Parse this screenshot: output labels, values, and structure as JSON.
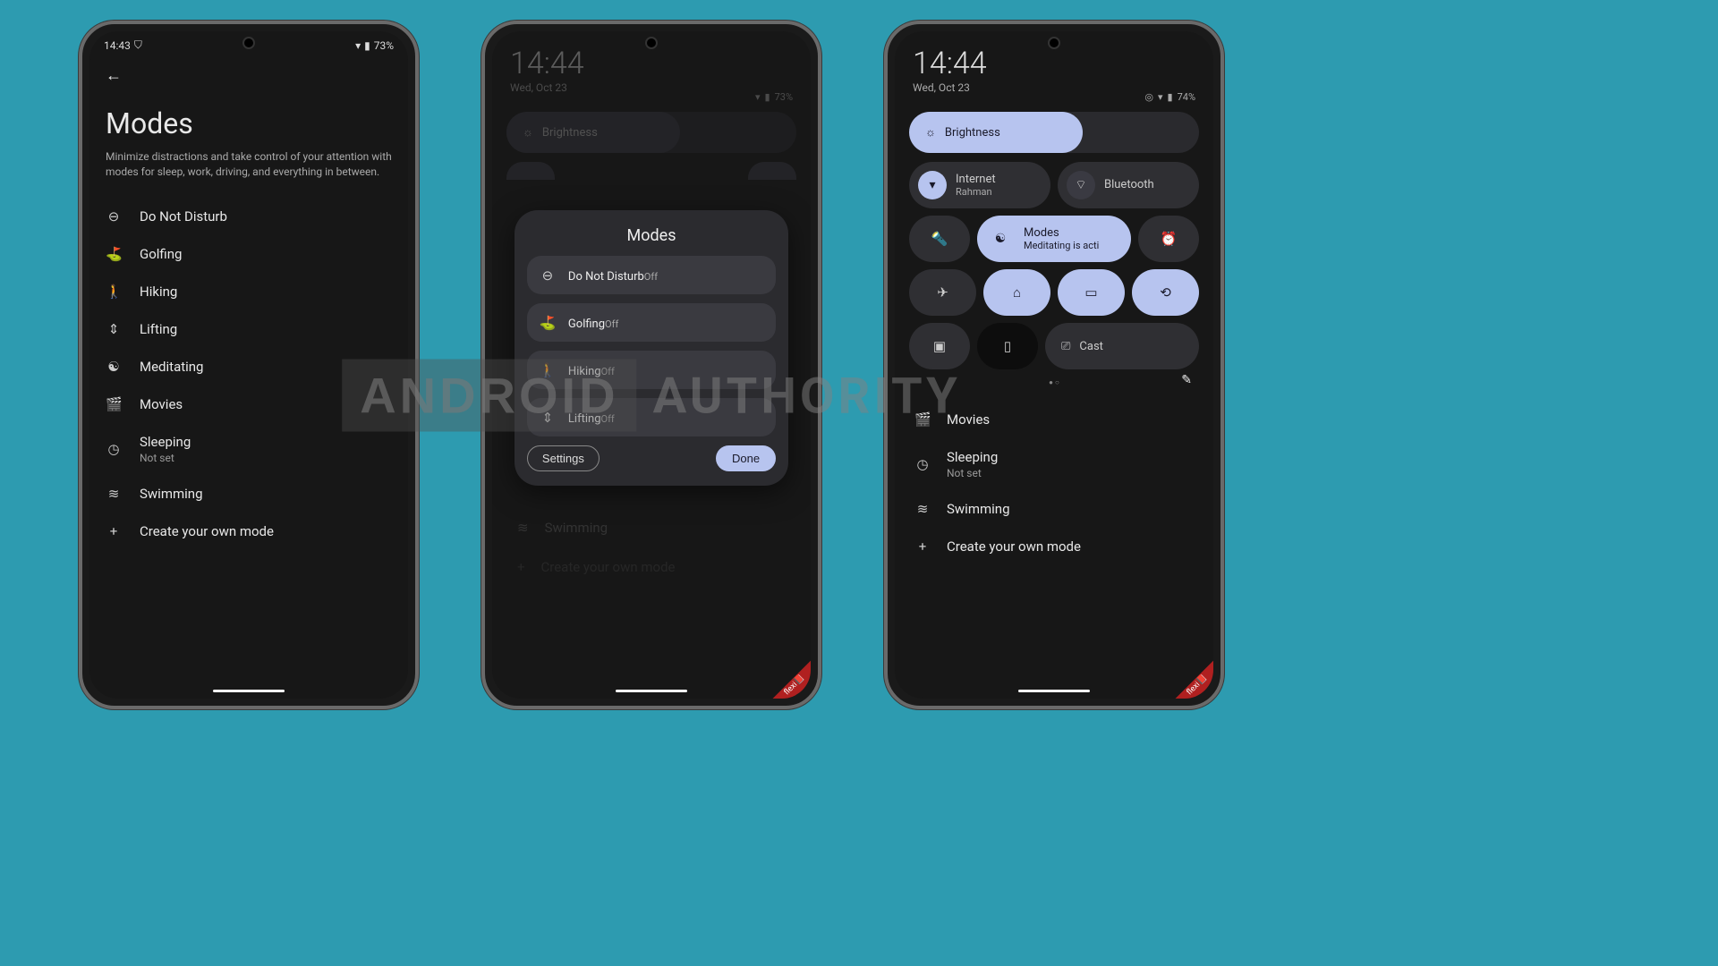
{
  "watermark": {
    "text1": "ANDROID",
    "text2": "AUTHORITY"
  },
  "phone1": {
    "status": {
      "time": "14:43",
      "battery": "73%"
    },
    "title": "Modes",
    "description": "Minimize distractions and take control of your attention with modes for sleep, work, driving, and everything in between.",
    "items": [
      {
        "icon": "⊖",
        "label": "Do Not Disturb"
      },
      {
        "icon": "⛳",
        "label": "Golfing"
      },
      {
        "icon": "🚶",
        "label": "Hiking"
      },
      {
        "icon": "⇕",
        "label": "Lifting"
      },
      {
        "icon": "☯",
        "label": "Meditating"
      },
      {
        "icon": "🎬",
        "label": "Movies"
      },
      {
        "icon": "◷",
        "label": "Sleeping",
        "sub": "Not set"
      },
      {
        "icon": "≋",
        "label": "Swimming"
      },
      {
        "icon": "+",
        "label": "Create your own mode"
      }
    ]
  },
  "phone2": {
    "time": "14:44",
    "date": "Wed, Oct 23",
    "battery": "73%",
    "brightness_label": "Brightness",
    "dialog": {
      "title": "Modes",
      "items": [
        {
          "icon": "⊖",
          "label": "Do Not Disturb",
          "sub": "Off"
        },
        {
          "icon": "⛳",
          "label": "Golfing",
          "sub": "Off"
        },
        {
          "icon": "🚶",
          "label": "Hiking",
          "sub": "Off"
        },
        {
          "icon": "⇕",
          "label": "Lifting",
          "sub": "Off"
        }
      ],
      "settings_label": "Settings",
      "done_label": "Done"
    },
    "swimming_label": "Swimming",
    "create_label": "Create your own mode",
    "flexi": "flexi📕"
  },
  "phone3": {
    "time": "14:44",
    "date": "Wed, Oct 23",
    "battery": "74%",
    "brightness_label": "Brightness",
    "tiles": {
      "internet": {
        "title": "Internet",
        "sub": "Rahman"
      },
      "bluetooth": {
        "title": "Bluetooth"
      },
      "modes": {
        "title": "Modes",
        "sub": "Meditating is acti"
      },
      "cast": {
        "title": "Cast"
      }
    },
    "list": [
      {
        "icon": "🎬",
        "label": "Movies"
      },
      {
        "icon": "◷",
        "label": "Sleeping",
        "sub": "Not set"
      },
      {
        "icon": "≋",
        "label": "Swimming"
      },
      {
        "icon": "+",
        "label": "Create your own mode"
      }
    ],
    "flexi": "flexi📕"
  }
}
